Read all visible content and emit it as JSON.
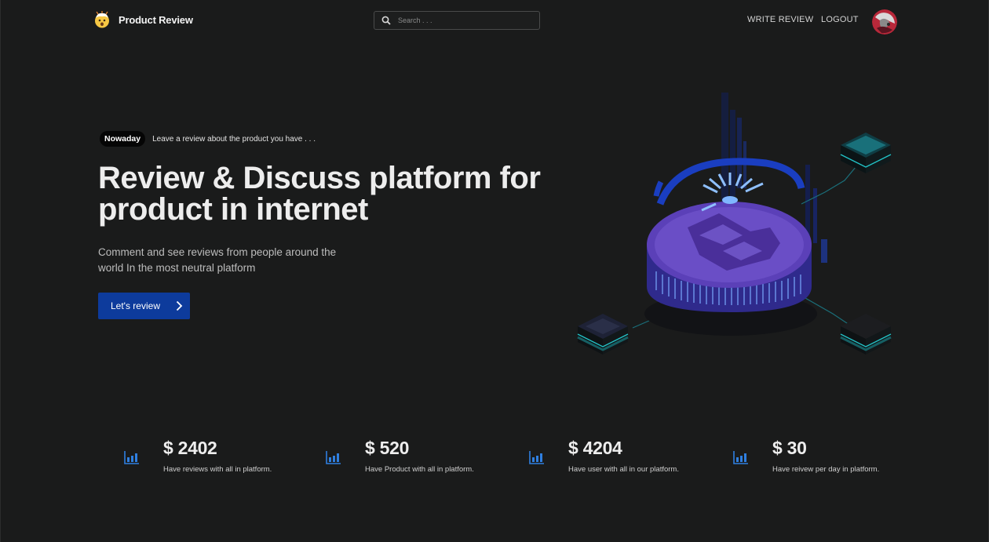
{
  "brand": {
    "name": "Product Review",
    "logo_icon": "exploding-head-emoji"
  },
  "search": {
    "placeholder": "Search . . ."
  },
  "nav": {
    "write_review": "WRITE REVIEW",
    "logout": "LOGOUT"
  },
  "hero": {
    "badge": "Nowaday",
    "badge_text": "Leave a review about the product you have . . .",
    "title": "Review & Discuss platform for product in internet",
    "subtitle": "Comment and see reviews from people around the world In the most neutral platform",
    "cta_label": "Let's review"
  },
  "stats": [
    {
      "value": "$ 2402",
      "description": "Have reviews with all in platform.",
      "icon": "bar-chart-icon"
    },
    {
      "value": "$ 520",
      "description": "Have Product with all in platform.",
      "icon": "bar-chart-icon"
    },
    {
      "value": "$ 4204",
      "description": "Have user with all in our platform.",
      "icon": "bar-chart-icon"
    },
    {
      "value": "$ 30",
      "description": "Have reivew per day in platform.",
      "icon": "bar-chart-icon"
    }
  ],
  "colors": {
    "background": "#1a1b1b",
    "accent": "#0d3b9c",
    "coin": "#5a3fb8",
    "stat_icon": "#2f7fe0"
  }
}
